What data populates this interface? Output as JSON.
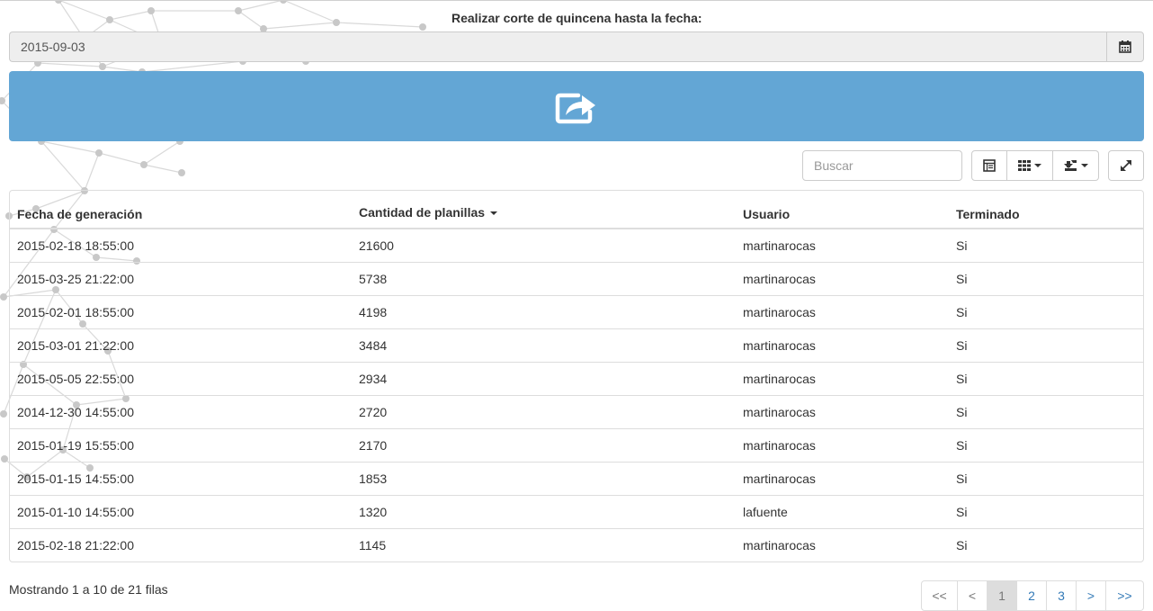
{
  "form": {
    "date_label": "Realizar corte de quincena hasta la fecha:",
    "date_value": "2015-09-03",
    "calendar_icon": "calendar-icon",
    "submit_icon": "share-icon"
  },
  "toolbar": {
    "search_placeholder": "Buscar",
    "icons": [
      "list-toggle-icon",
      "columns-icon",
      "export-icon",
      "fullscreen-icon"
    ]
  },
  "table": {
    "columns": [
      "Fecha de generación",
      "Cantidad de planillas",
      "Usuario",
      "Terminado"
    ],
    "sorted_column": "Cantidad de planillas",
    "rows": [
      [
        "2015-02-18 18:55:00",
        "21600",
        "martinarocas",
        "Si"
      ],
      [
        "2015-03-25 21:22:00",
        "5738",
        "martinarocas",
        "Si"
      ],
      [
        "2015-02-01 18:55:00",
        "4198",
        "martinarocas",
        "Si"
      ],
      [
        "2015-03-01 21:22:00",
        "3484",
        "martinarocas",
        "Si"
      ],
      [
        "2015-05-05 22:55:00",
        "2934",
        "martinarocas",
        "Si"
      ],
      [
        "2014-12-30 14:55:00",
        "2720",
        "martinarocas",
        "Si"
      ],
      [
        "2015-01-19 15:55:00",
        "2170",
        "martinarocas",
        "Si"
      ],
      [
        "2015-01-15 14:55:00",
        "1853",
        "martinarocas",
        "Si"
      ],
      [
        "2015-01-10 14:55:00",
        "1320",
        "lafuente",
        "Si"
      ],
      [
        "2015-02-18 21:22:00",
        "1145",
        "martinarocas",
        "Si"
      ]
    ]
  },
  "footer": {
    "summary": "Mostrando 1 a 10 de 21 filas",
    "pages": [
      "<<",
      "<",
      "1",
      "2",
      "3",
      ">",
      ">>"
    ],
    "active_page": "1"
  },
  "colors": {
    "primary_button": "#63a6d5",
    "link": "#337ab7",
    "border": "#dddddd"
  }
}
